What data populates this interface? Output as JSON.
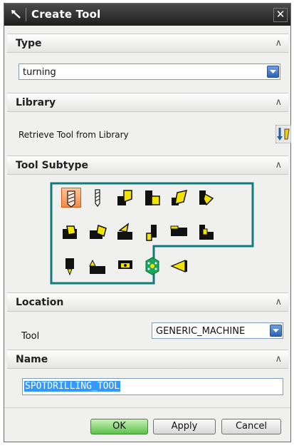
{
  "window": {
    "title": "Create Tool"
  },
  "sections": {
    "type": {
      "label": "Type",
      "value": "turning"
    },
    "library": {
      "label": "Library",
      "retrieve_label": "Retrieve Tool from Library"
    },
    "subtype": {
      "label": "Tool Subtype",
      "selected_index": 0,
      "highlight_color": "#127c7c"
    },
    "location": {
      "label": "Location",
      "tool_label": "Tool",
      "tool_value": "GENERIC_MACHINE"
    },
    "name": {
      "label": "Name",
      "value": "SPOTDRILLING_TOOL"
    }
  },
  "buttons": {
    "ok": "OK",
    "apply": "Apply",
    "cancel": "Cancel"
  },
  "colors": {
    "accent": "#f08a45",
    "teal": "#127c7c",
    "icon_yellow": "#f3e300"
  }
}
